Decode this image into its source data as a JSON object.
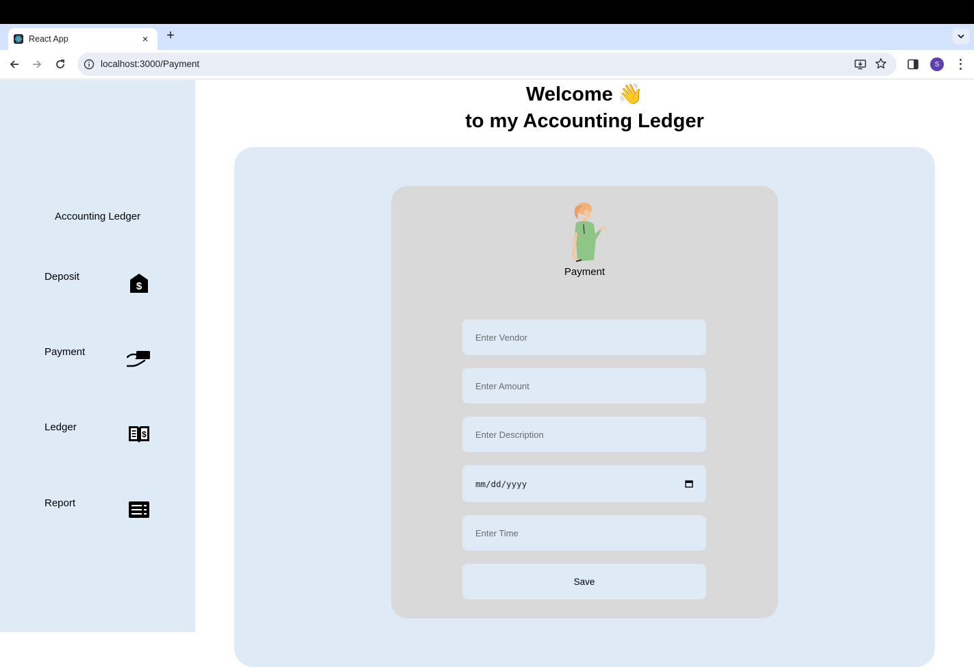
{
  "browser": {
    "tab_title": "React App",
    "url": "localhost:3000/Payment",
    "profile_initial": "S",
    "new_tab_label": "+",
    "close_tab_label": "×"
  },
  "sidebar": {
    "brand": "Accounting Ledger",
    "items": [
      {
        "label": "Deposit",
        "icon": "house-dollar-icon"
      },
      {
        "label": "Payment",
        "icon": "hand-card-icon"
      },
      {
        "label": "Ledger",
        "icon": "book-dollar-icon"
      },
      {
        "label": "Report",
        "icon": "report-list-icon"
      }
    ]
  },
  "main": {
    "heading_line1": "Welcome 👋",
    "heading_line2": "to my Accounting Ledger",
    "form": {
      "title": "Payment",
      "vendor_placeholder": "Enter Vendor",
      "amount_placeholder": "Enter Amount",
      "description_placeholder": "Enter Description",
      "date_value": "mm/dd/yyyy",
      "time_placeholder": "Enter Time",
      "save_label": "Save"
    }
  },
  "colors": {
    "panel": "#deebf7",
    "card": "#d9d9d9",
    "tabstrip": "#d3e3fd"
  }
}
